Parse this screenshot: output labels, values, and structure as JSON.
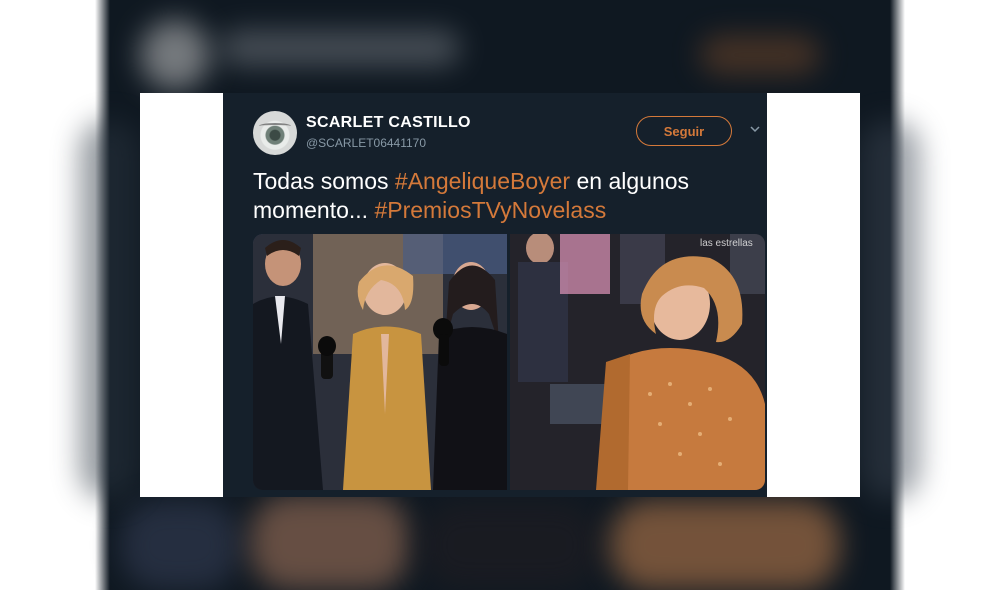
{
  "tweet": {
    "display_name": "SCARLET CASTILLO",
    "handle": "@SCARLET06441170",
    "follow_label": "Seguir",
    "text_parts": {
      "t1": "Todas somos ",
      "h1": "#AngeliqueBoyer",
      "t2": " en algunos momento... ",
      "h2": "#PremiosTVyNovelass"
    },
    "media": {
      "right_watermark": "las estrellas"
    }
  },
  "colors": {
    "tweet_background": "#15202b",
    "accent": "#d4793a",
    "secondary_text": "#8899a6"
  },
  "icons": {
    "dropdown": "chevron-down-icon",
    "avatar": "avatar"
  }
}
